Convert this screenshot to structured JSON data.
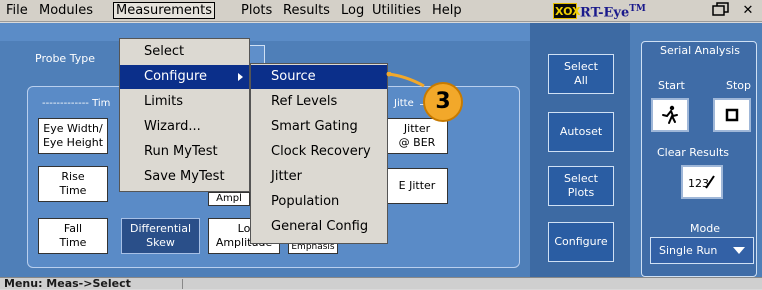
{
  "menubar": {
    "items": [
      "File",
      "Modules",
      "Measurements",
      "Plots",
      "Results",
      "Log",
      "Utilities",
      "Help"
    ],
    "logo_text": "XOX",
    "app_name": "RT-Eye",
    "app_tm": "TM"
  },
  "probe": {
    "label": "Probe Type"
  },
  "sections": {
    "timing_title": "------------- Tim",
    "jitter_title": "Jitte"
  },
  "buttons": {
    "eye_width": [
      "Eye Width/",
      "Eye Height"
    ],
    "rise_time": [
      "Rise",
      "Time"
    ],
    "fall_time": [
      "Fall",
      "Time"
    ],
    "differential_skew": [
      "Differential",
      "Skew"
    ],
    "lo_amp": [
      "Lo",
      "Amplitude"
    ],
    "emphasis": "Emphasis",
    "amp_partial": "Ampl",
    "jitter_ber": [
      "Jitter",
      "@ BER"
    ],
    "e_jitter": "E Jitter"
  },
  "right_buttons": {
    "select_all": [
      "Select",
      "All"
    ],
    "autoset": "Autoset",
    "select_plots": [
      "Select",
      "Plots"
    ],
    "configure": "Configure"
  },
  "serial_panel": {
    "title": "Serial Analysis",
    "start_label": "Start",
    "stop_label": "Stop",
    "clear_results": "Clear Results",
    "mode_label": "Mode",
    "mode_value": "Single Run"
  },
  "measurements_menu": {
    "items": [
      "Select",
      "Configure",
      "Limits",
      "Wizard...",
      "Run MyTest",
      "Save MyTest"
    ],
    "selected": "Configure"
  },
  "configure_submenu": {
    "items": [
      "Source",
      "Ref Levels",
      "Smart Gating",
      "Clock Recovery",
      "Jitter",
      "Population",
      "General Config"
    ],
    "selected": "Source"
  },
  "callout": {
    "number": "3"
  },
  "status": {
    "text": "Menu: Meas->Select"
  },
  "colors": {
    "main_bg": "#4f7fb8",
    "menu_highlight": "#0b2f8a",
    "callout": "#f2a82a"
  }
}
